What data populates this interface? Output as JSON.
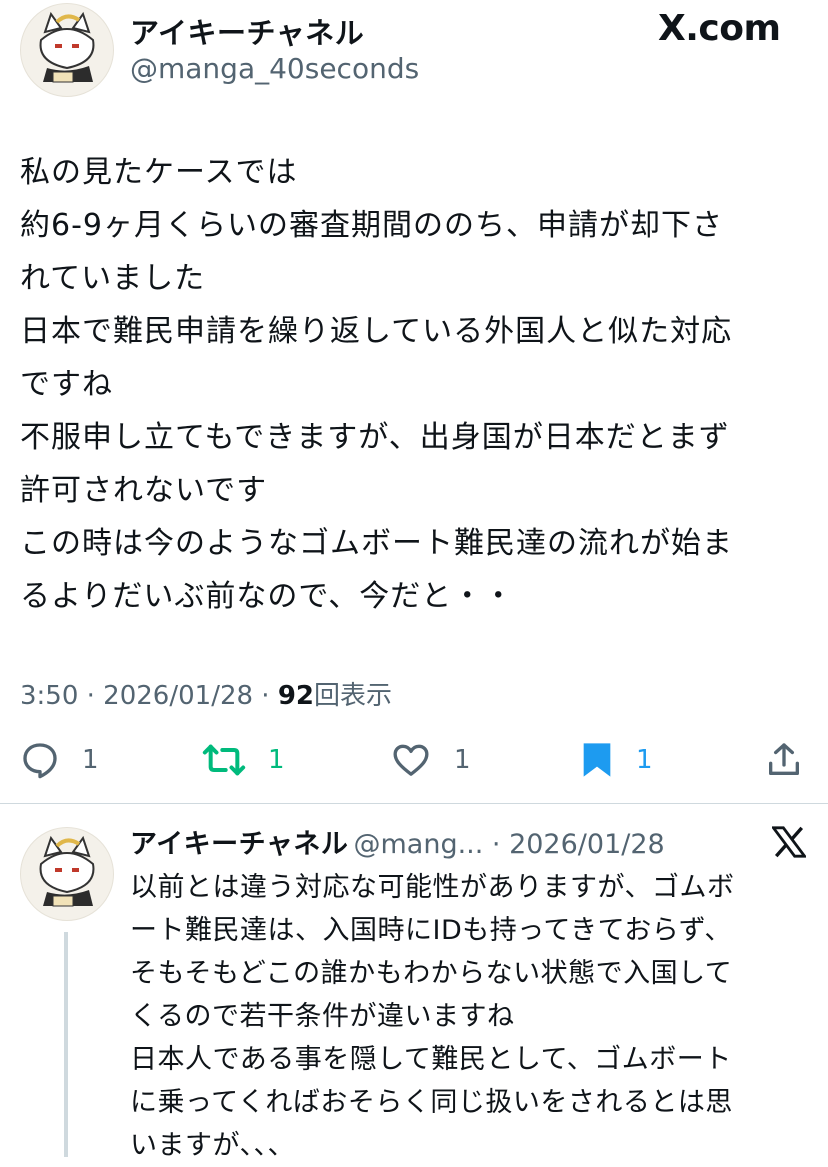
{
  "header": {
    "display_name": "アイキーチャネル",
    "handle": "@manga_40seconds",
    "brand": "X.com",
    "avatar_icon": "fox-mascot-avatar-icon"
  },
  "tweet": {
    "lines": [
      "私の見たケースでは",
      "約6-9ヶ月くらいの審査期間ののち、申請が却下さ",
      "れていました",
      "日本で難民申請を繰り返している外国人と似た対応",
      "ですね",
      "不服申し立てもできますが、出身国が日本だとまず",
      "許可されないです",
      "この時は今のようなゴムボート難民達の流れが始ま",
      "るよりだいぶ前なので、今だと・・"
    ],
    "time": "3:50 · 2026/01/28 · ",
    "views": "92",
    "views_label": "回表示"
  },
  "actions": {
    "reply_count": "1",
    "retweet_count": "1",
    "like_count": "1",
    "bookmark_count": "1",
    "accent_green": "#00ba7c",
    "accent_blue": "#1d9bf0"
  },
  "reply": {
    "display_name": "アイキーチャネル",
    "handle_date": "@mang... · 2026/01/28",
    "lines": [
      "以前とは違う対応な可能性がありますが、ゴムボ",
      "ート難民達は、入国時にIDも持ってきておらず、",
      "そもそもどこの誰かもわからない状態で入国して",
      "くるので若干条件が違いますね",
      "日本人である事を隠して難民として、ゴムボート",
      "に乗ってくればおそらく同じ扱いをされるとは思",
      "いますが、、、"
    ]
  }
}
